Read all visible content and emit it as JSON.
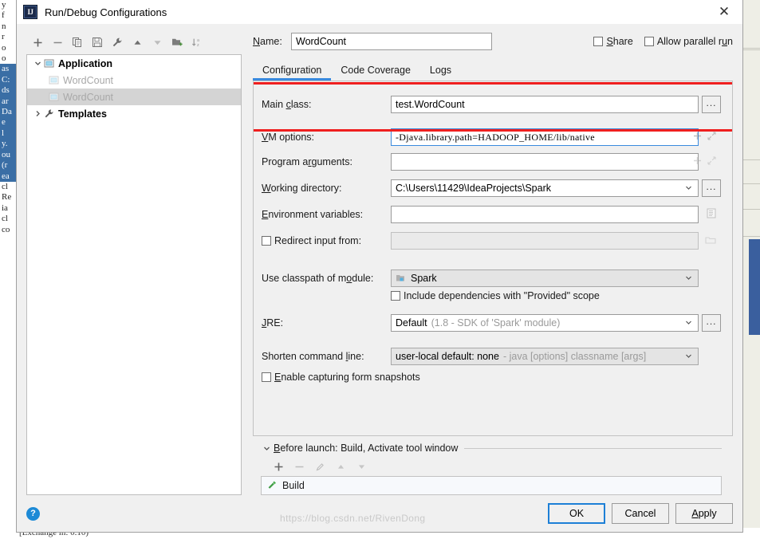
{
  "window": {
    "title": "Run/Debug Configurations",
    "app_icon": "intellij-idea-icon",
    "close_icon": "✕"
  },
  "tree_toolbar": [
    {
      "name": "add",
      "icon": "plus-icon"
    },
    {
      "name": "remove",
      "icon": "minus-icon"
    },
    {
      "name": "copy",
      "icon": "copy-icon"
    },
    {
      "name": "save",
      "icon": "save-icon"
    },
    {
      "name": "edit-templates",
      "icon": "wrench-icon"
    },
    {
      "name": "move-up",
      "icon": "arrow-up-icon"
    },
    {
      "name": "move-down",
      "icon": "arrow-down-icon"
    },
    {
      "name": "new-folder",
      "icon": "new-folder-icon"
    },
    {
      "name": "sort",
      "icon": "sort-alpha-icon"
    }
  ],
  "tree": {
    "nodes": [
      {
        "label": "Application",
        "icon": "application-icon",
        "twisty": "v",
        "muted": false,
        "selected": false,
        "child": false
      },
      {
        "label": "WordCount",
        "icon": "application-icon",
        "twisty": "",
        "muted": true,
        "selected": false,
        "child": true
      },
      {
        "label": "WordCount",
        "icon": "application-icon",
        "twisty": "",
        "muted": true,
        "selected": true,
        "child": true
      },
      {
        "label": "Templates",
        "icon": "wrench-icon",
        "twisty": ">",
        "muted": false,
        "selected": false,
        "child": false
      }
    ]
  },
  "name_row": {
    "label": "Name:",
    "value": "WordCount",
    "placeholder": "",
    "share": {
      "label": "Share",
      "checked": false
    },
    "parallel": {
      "label": "Allow parallel run",
      "checked": false
    }
  },
  "tabs": [
    {
      "label": "Configuration",
      "active": true
    },
    {
      "label": "Code Coverage",
      "active": false
    },
    {
      "label": "Logs",
      "active": false
    }
  ],
  "fields": {
    "main_class": {
      "label": "Main class:",
      "value": "test.WordCount",
      "browse": "...",
      "browse_icon": "ellipsis-icon"
    },
    "vm_options": {
      "label": "VM options:",
      "value": "-Djava.library.path=HADOOP_HOME/lib/native",
      "expand_icon": "expand-icon",
      "insert_icon": "plus-icon",
      "highlighted": true,
      "highlight_color": "#ef1f1f"
    },
    "program_arguments": {
      "label": "Program arguments:",
      "value": "",
      "expand_icon": "expand-icon",
      "insert_icon": "plus-icon"
    },
    "working_directory": {
      "label": "Working directory:",
      "value": "C:\\Users\\11429\\IdeaProjects\\Spark",
      "caret_icon": "chevron-down-icon",
      "browse": "...",
      "browse_icon": "ellipsis-icon"
    },
    "environment_variables": {
      "label": "Environment variables:",
      "value": "",
      "editor_icon": "list-editor-icon"
    },
    "redirect_input": {
      "label": "Redirect input from:",
      "checked": false,
      "value": "",
      "folder_icon": "folder-icon"
    },
    "classpath_module": {
      "label": "Use classpath of module:",
      "value": "Spark",
      "module_icon": "module-icon",
      "caret_icon": "chevron-down-icon"
    },
    "include_provided": {
      "label": "Include dependencies with \"Provided\" scope",
      "checked": false
    },
    "jre": {
      "label": "JRE:",
      "value": "Default",
      "hint": "(1.8 - SDK of 'Spark' module)",
      "caret_icon": "chevron-down-icon",
      "browse": "...",
      "browse_icon": "ellipsis-icon"
    },
    "shorten_command_line": {
      "label": "Shorten command line:",
      "value": "user-local default: none",
      "hint": "- java [options] classname [args]",
      "caret_icon": "chevron-down-icon"
    },
    "form_snapshots": {
      "label": "Enable capturing form snapshots",
      "checked": false
    }
  },
  "before_launch": {
    "title": "Before launch: Build, Activate tool window",
    "twisty": "v",
    "toolbar": [
      {
        "name": "add",
        "icon": "plus-icon",
        "enabled": true
      },
      {
        "name": "remove",
        "icon": "minus-icon",
        "enabled": false
      },
      {
        "name": "edit",
        "icon": "pencil-icon",
        "enabled": false
      },
      {
        "name": "move-up",
        "icon": "arrow-up-icon",
        "enabled": false
      },
      {
        "name": "move-down",
        "icon": "arrow-down-icon",
        "enabled": false
      }
    ],
    "items": [
      {
        "label": "Build",
        "icon": "hammer-icon"
      }
    ]
  },
  "footer": {
    "help_icon": "question-mark-icon",
    "help_label": "?",
    "buttons": [
      {
        "label": "OK",
        "default": true
      },
      {
        "label": "Cancel",
        "default": false
      },
      {
        "label": "Apply",
        "default": false
      }
    ]
  },
  "watermark": "https://blog.csdn.net/RivenDong",
  "background": {
    "left_code": [
      "y",
      "f",
      "n",
      "r",
      "",
      "o",
      "o",
      "as",
      "C:",
      "ds",
      "ar",
      "Da",
      "e",
      "l",
      "y.",
      "ou",
      "(r",
      "ea",
      "",
      "cl",
      "Re",
      "ia",
      "cl",
      "co"
    ],
    "bottom_text": "[Exchange in: 0.10)"
  }
}
